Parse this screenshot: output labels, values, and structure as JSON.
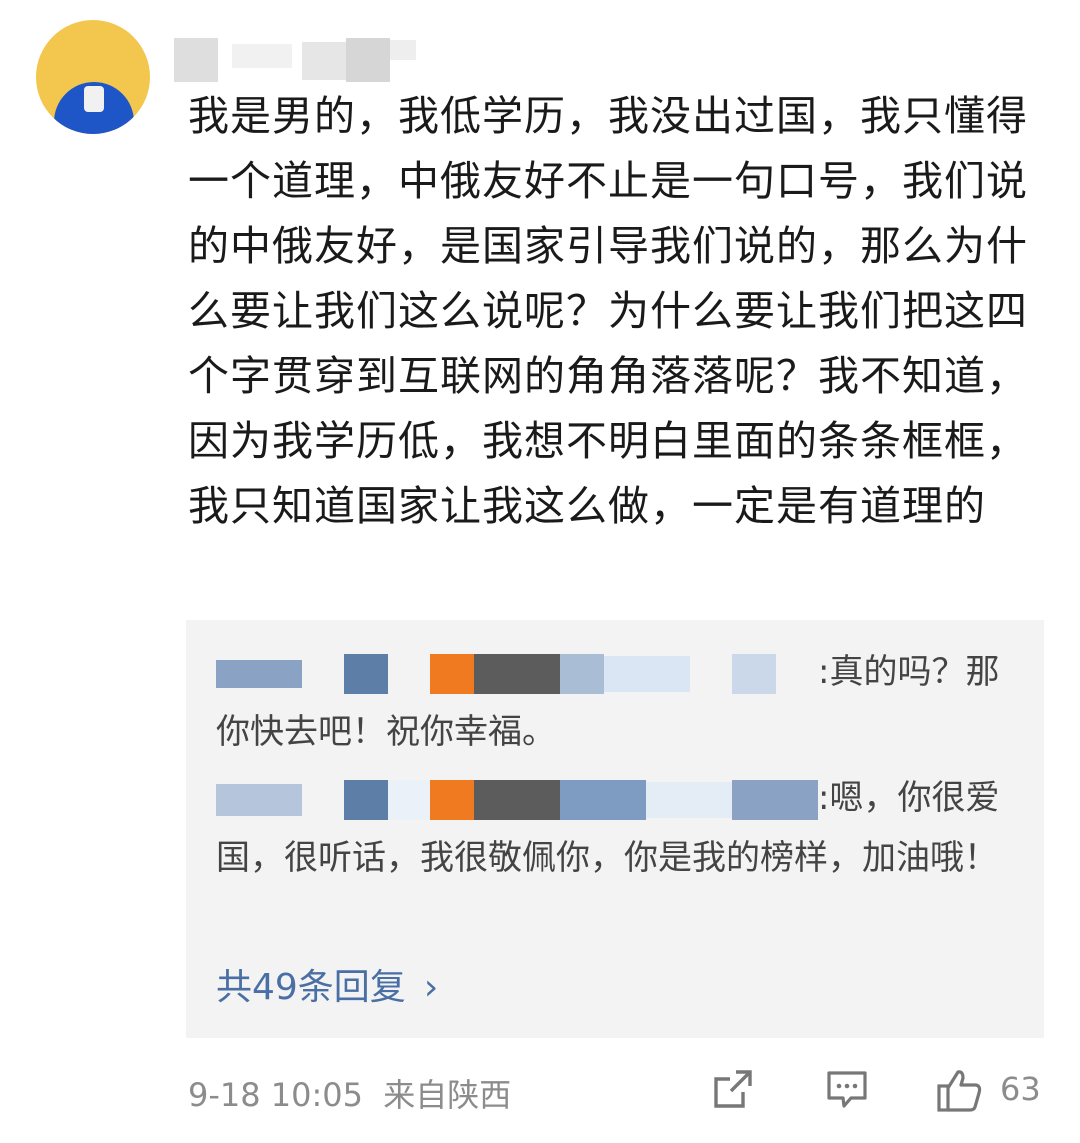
{
  "post": {
    "content": "我是男的，我低学历，我没出过国，我只懂得一个道理，中俄友好不止是一句口号，我们说的中俄友好，是国家引导我们说的，那么为什么要让我们这么说呢？为什么要让我们把这四个字贯穿到互联网的角角落落呢？我不知道，因为我学历低，我想不明白里面的条条框框，我只知道国家让我这么做，一定是有道理的",
    "date": "9-18 10:05",
    "location": "来自陕西",
    "like_count": "63"
  },
  "replies": [
    {
      "text": ":真的吗？那你快去吧！祝你幸福。"
    },
    {
      "text": ":嗯，你很爱国，很听话，我很敬佩你，你是我的榜样，加油哦！"
    }
  ],
  "reply_summary": {
    "label": "共49条回复",
    "chevron": "›"
  },
  "icons": {
    "share": "share-icon",
    "comment": "comment-icon",
    "like": "thumbs-up-icon"
  },
  "colors": {
    "link": "#5b7fb0",
    "muted": "#8c8c8c",
    "reply_bg": "#f3f3f3"
  }
}
